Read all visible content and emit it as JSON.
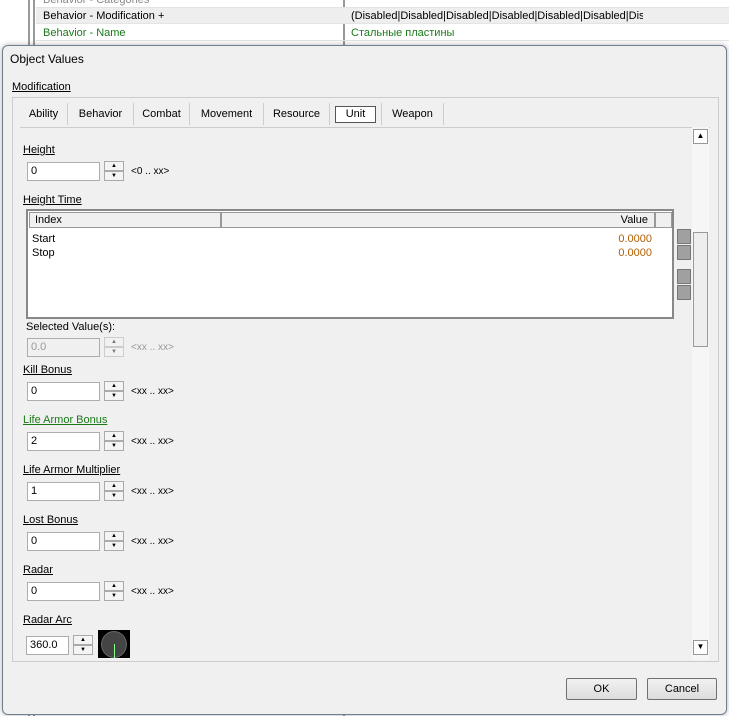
{
  "background_rows": [
    {
      "name": "Behavior - Categories",
      "value": ""
    },
    {
      "name": "Behavior - Modification +",
      "value": "(Disabled|Disabled|Disabled|Disabled|Disabled|Disabled|Disable"
    },
    {
      "name": "Behavior - Name",
      "value": "Стальные пластины"
    }
  ],
  "dialog": {
    "title": "Object Values",
    "group_label": "Modification",
    "tabs": [
      "Ability",
      "Behavior",
      "Combat",
      "Movement",
      "Resource",
      "Unit",
      "Weapon"
    ],
    "active_tab": "Unit",
    "fields": {
      "height": {
        "label": "Height",
        "value": "0",
        "range": "<0 .. xx>"
      },
      "height_time": {
        "label": "Height Time",
        "columns": [
          "Index",
          "Value"
        ],
        "rows": [
          {
            "index": "Start",
            "value": "0.0000"
          },
          {
            "index": "Stop",
            "value": "0.0000"
          }
        ],
        "selected_label": "Selected Value(s):",
        "selected_value": "0.0",
        "selected_range": "<xx .. xx>"
      },
      "kill_bonus": {
        "label": "Kill Bonus",
        "value": "0",
        "range": "<xx .. xx>"
      },
      "life_armor_bonus": {
        "label": "Life Armor Bonus",
        "value": "2",
        "range": "<xx .. xx>"
      },
      "life_armor_multiplier": {
        "label": "Life Armor Multiplier",
        "value": "1",
        "range": "<xx .. xx>"
      },
      "lost_bonus": {
        "label": "Lost Bonus",
        "value": "0",
        "range": "<xx .. xx>"
      },
      "radar": {
        "label": "Radar",
        "value": "0",
        "range": "<xx .. xx>"
      },
      "radar_arc": {
        "label": "Radar Arc",
        "value": "360.0"
      }
    },
    "ok": "OK",
    "cancel": "Cancel",
    "colors": {
      "modified": "#1a7a1a",
      "value_text": "#b06000"
    }
  }
}
